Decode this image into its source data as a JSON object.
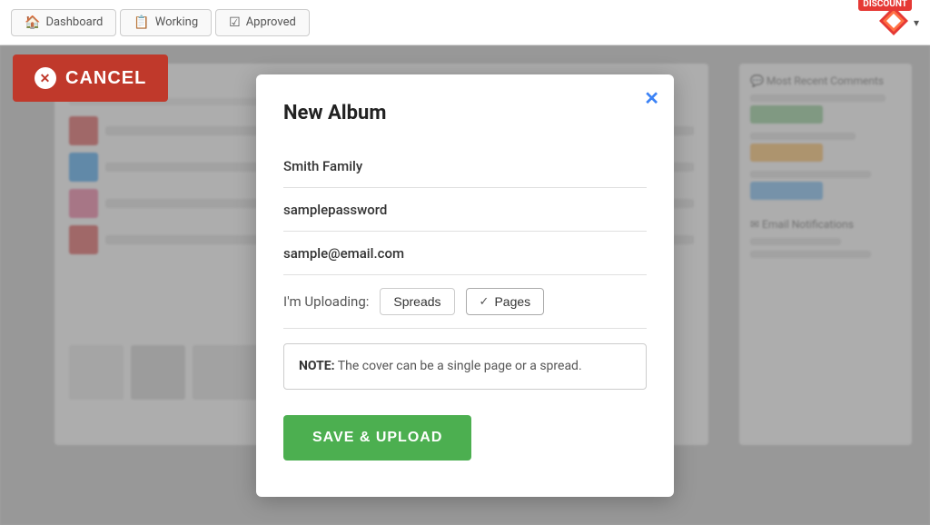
{
  "nav": {
    "tabs": [
      {
        "label": "Dashboard",
        "icon": "🏠",
        "name": "dashboard"
      },
      {
        "label": "Working",
        "icon": "📋",
        "name": "working"
      },
      {
        "label": "Approved",
        "icon": "☑",
        "name": "approved"
      }
    ],
    "discount_badge": "DISCOUNT"
  },
  "cancel_button": {
    "label": "CANCEL",
    "x": "✕"
  },
  "modal": {
    "title": "New Album",
    "close_icon": "✕",
    "fields": {
      "name": "Smith Family",
      "password": "samplepassword",
      "email": "sample@email.com"
    },
    "upload": {
      "label": "I'm Uploading:",
      "option_spreads": "Spreads",
      "option_pages": "Pages",
      "check": "✓"
    },
    "note": {
      "bold": "NOTE:",
      "text": " The cover can be a single page or a spread."
    },
    "save_label": "SAVE & UPLOAD"
  }
}
